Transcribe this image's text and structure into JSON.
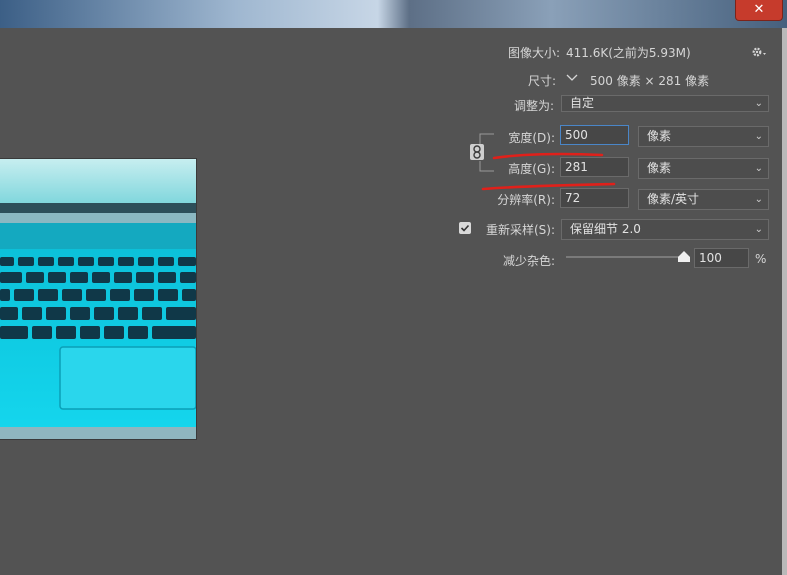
{
  "window": {
    "close_label": "✕"
  },
  "image_size": {
    "label": "图像大小:",
    "value": "411.6K(之前为5.93M)"
  },
  "dimensions": {
    "label": "尺寸:",
    "value": "500 像素 × 281 像素"
  },
  "fit_to": {
    "label": "调整为:",
    "selected": "自定"
  },
  "width": {
    "label": "宽度(D):",
    "value": "500",
    "unit": "像素"
  },
  "height": {
    "label": "高度(G):",
    "value": "281",
    "unit": "像素"
  },
  "resolution": {
    "label": "分辨率(R):",
    "value": "72",
    "unit": "像素/英寸"
  },
  "resample": {
    "label": "重新采样(S):",
    "checked": true,
    "method": "保留细节 2.0"
  },
  "noise": {
    "label": "减少杂色:",
    "value": "100",
    "unit": "%",
    "level_percent": 100
  },
  "colors": {
    "accent_field": "#4a86c8",
    "annotation_red": "#e0201a",
    "panel": "#535353"
  },
  "icons": {
    "gear": "gear-icon",
    "link": "chain-link-icon",
    "chevron": "chevron-down-icon"
  }
}
